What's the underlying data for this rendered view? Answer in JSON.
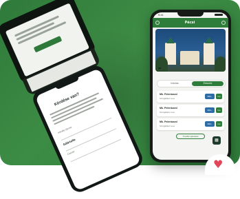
{
  "image": {
    "subject": "Two smartphone mockups showing a mobile ticketing app on a green background",
    "colors": {
      "background": "#3d8c45",
      "app_primary": "#2e7d3b",
      "price_badge": "#2c6da8",
      "heart": "#e0485a"
    }
  },
  "left_phone": {
    "heading": "Kérdése van?",
    "field_labels": [
      "Kérdés típusa",
      "Gábrielle",
      "Üzenet"
    ]
  },
  "right_phone": {
    "status_time": "9:41",
    "logo": "Pécsi",
    "toggle": [
      "Indulás",
      "Érkezés"
    ],
    "tickets": [
      {
        "title": "Mk. Pelenkavol",
        "sub": "Szolgáltató neve",
        "price": "990,-",
        "action": "Go"
      },
      {
        "title": "Mk. Pelenkavol",
        "sub": "Szolgáltató neve",
        "price": "990,-",
        "action": "Go"
      },
      {
        "title": "Mk. Pelenkavol",
        "sub": "Szolgáltató neve",
        "price": "990,-",
        "action": "Go"
      }
    ],
    "more_button": "További ajánlatok"
  },
  "icons": {
    "heart": "heart-icon",
    "fab": "grid-icon"
  }
}
